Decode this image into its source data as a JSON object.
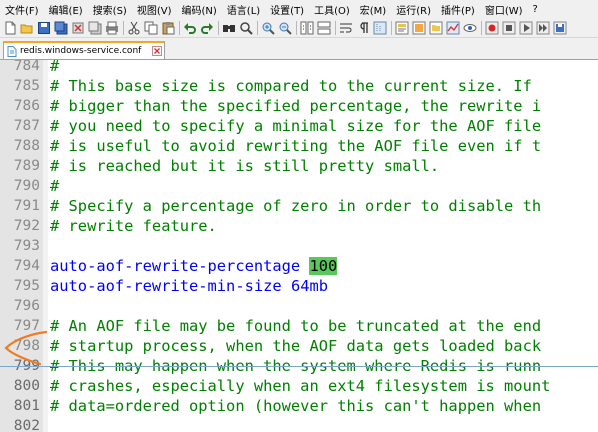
{
  "menu": [
    "文件(F)",
    "编辑(E)",
    "搜索(S)",
    "视图(V)",
    "编码(N)",
    "语言(L)",
    "设置(T)",
    "工具(O)",
    "宏(M)",
    "运行(R)",
    "插件(P)",
    "窗口(W)",
    "?"
  ],
  "tab": {
    "filename": "redis.windows-service.conf"
  },
  "colors": {
    "comment": "#008000",
    "keyword": "#0000ff",
    "highlight": "#5ac85a",
    "accent_tab": "#f5a623"
  },
  "editor": {
    "lines": [
      {
        "num": "784",
        "text": "#"
      },
      {
        "num": "785",
        "text": "# This base size is compared to the current size. If"
      },
      {
        "num": "786",
        "text": "# bigger than the specified percentage, the rewrite i"
      },
      {
        "num": "787",
        "text": "# you need to specify a minimal size for the AOF file"
      },
      {
        "num": "788",
        "text": "# is useful to avoid rewriting the AOF file even if t"
      },
      {
        "num": "789",
        "text": "# is reached but it is still pretty small."
      },
      {
        "num": "790",
        "text": "#"
      },
      {
        "num": "791",
        "text": "# Specify a percentage of zero in order to disable th"
      },
      {
        "num": "792",
        "text": "# rewrite feature."
      },
      {
        "num": "793",
        "text": ""
      },
      {
        "num": "794",
        "key": "auto-aof-rewrite-percentage",
        "value": "100"
      },
      {
        "num": "795",
        "key": "auto-aof-rewrite-min-size",
        "value": "64mb"
      },
      {
        "num": "796",
        "text": ""
      },
      {
        "num": "797",
        "text": "# An AOF file may be found to be truncated at the end"
      },
      {
        "num": "798",
        "text": "# startup process, when the AOF data gets loaded back"
      },
      {
        "num": "799",
        "text": "# This may happen when the system where Redis is runn"
      },
      {
        "num": "800",
        "text": "# crashes, especially when an ext4 filesystem is mount"
      },
      {
        "num": "801",
        "text": "# data=ordered option (however this can't happen when"
      },
      {
        "num": "802",
        "text": ""
      }
    ]
  }
}
